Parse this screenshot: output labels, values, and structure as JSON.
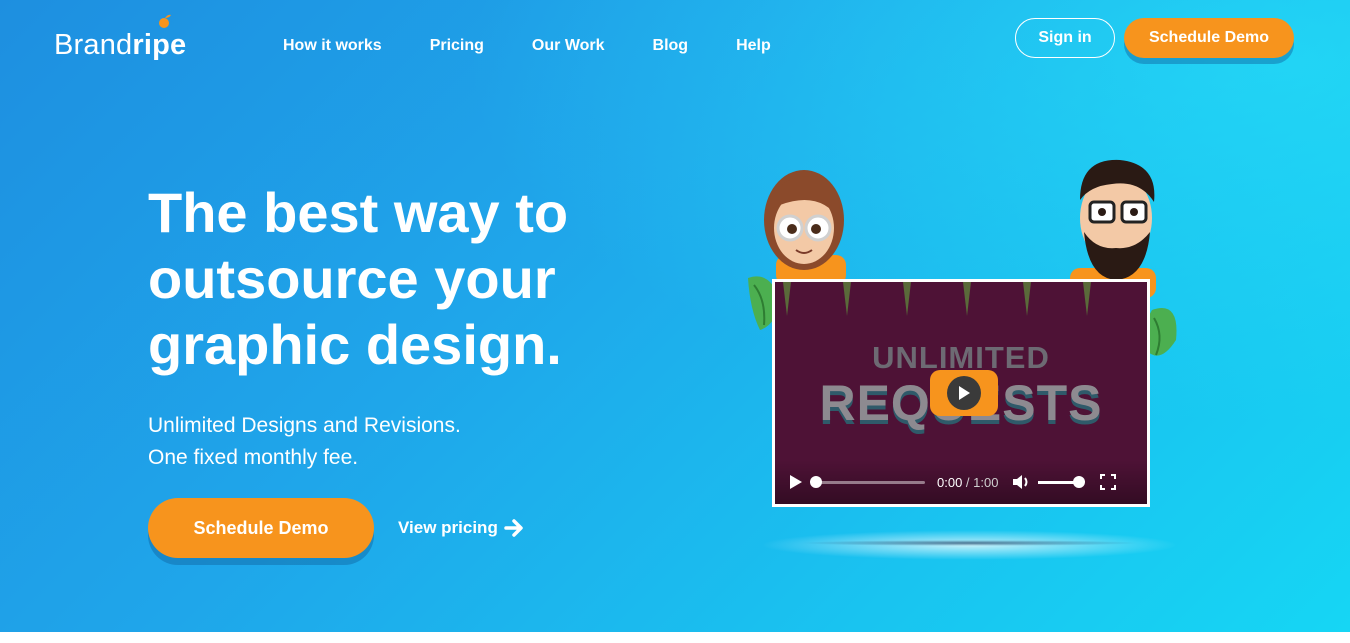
{
  "brand": {
    "name_thin": "Brand",
    "name_bold": "ripe",
    "accent_color": "#f7941d"
  },
  "nav": {
    "items": [
      {
        "label": "How it works"
      },
      {
        "label": "Pricing"
      },
      {
        "label": "Our Work"
      },
      {
        "label": "Blog"
      },
      {
        "label": "Help"
      }
    ],
    "sign_in": "Sign in",
    "schedule_demo": "Schedule Demo"
  },
  "hero": {
    "headline": [
      "The best way to",
      "outsource your",
      "graphic design."
    ],
    "sub_line_1": "Unlimited Designs and Revisions.",
    "sub_line_2": "One fixed monthly fee.",
    "cta_primary": "Schedule Demo",
    "cta_secondary": "View pricing",
    "arrow_icon": "arrow-right-icon"
  },
  "video": {
    "title_line_1": "UNLIMITED",
    "title_line_2": "REQUESTS",
    "current_time": "0:00",
    "separator": " / ",
    "duration": "1:00",
    "progress": 0,
    "volume": 1.0,
    "icons": [
      "play-icon",
      "volume-icon",
      "fullscreen-icon"
    ]
  },
  "colors": {
    "background_start": "#1e8fe0",
    "background_end": "#16d6f4",
    "button": "#f7941d",
    "video_bg": "#4e1236"
  }
}
